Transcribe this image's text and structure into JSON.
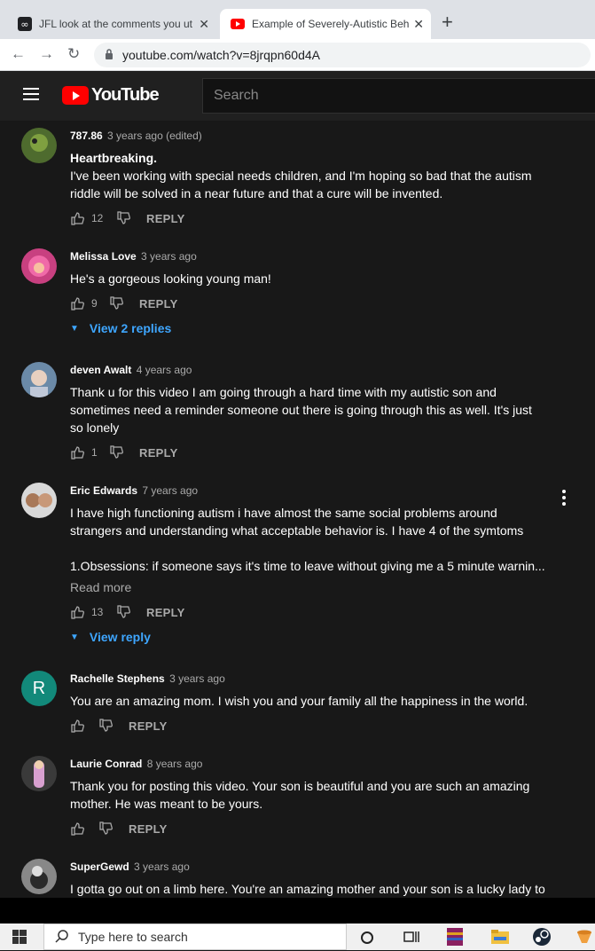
{
  "browser": {
    "tabs": [
      {
        "title": "JFL look at the comments you ut",
        "icon": "infinity-icon"
      },
      {
        "title": "Example of Severely-Autistic Beh",
        "icon": "youtube-icon"
      }
    ],
    "url": "youtube.com/watch?v=8jrqpn60d4A"
  },
  "youtube": {
    "logo_text": "YouTube",
    "search_placeholder": "Search"
  },
  "comments": [
    {
      "author": "787.86",
      "time": "3 years ago (edited)",
      "lines": [
        "Heartbreaking.",
        "I've been working with special needs children, and I'm hoping so bad that the autism",
        "riddle will be solved in a near future and that a cure will be invented."
      ],
      "likes": "12",
      "reply": "REPLY",
      "avatar_color": "#5a7a3a"
    },
    {
      "author": "Melissa Love",
      "time": "3 years ago",
      "lines": [
        "He's a gorgeous looking young man!"
      ],
      "likes": "9",
      "reply": "REPLY",
      "view_replies": "View 2 replies",
      "avatar_color": "#e85a9a"
    },
    {
      "author": "deven Awalt",
      "time": "4 years ago",
      "lines": [
        "Thank u for this video I am going through a hard time with my autistic son and",
        "sometimes need a reminder someone out there is going through this as well. It's just",
        "so lonely"
      ],
      "likes": "1",
      "reply": "REPLY",
      "avatar_color": "#8aa0b8"
    },
    {
      "author": "Eric Edwards",
      "time": "7 years ago",
      "lines": [
        "I have high functioning autism i have almost the same social problems around",
        "strangers and understanding what acceptable behavior is. I have 4 of the symtoms",
        "",
        "1.Obsessions: if someone says it's time to leave without giving me a 5 minute warnin..."
      ],
      "read_more": "Read more",
      "likes": "13",
      "reply": "REPLY",
      "view_replies": "View reply",
      "avatar_color": "#9a7a5a"
    },
    {
      "author": "Rachelle Stephens",
      "time": "3 years ago",
      "lines": [
        "You are an amazing mom. I wish you and your family all the happiness in the world."
      ],
      "likes": "",
      "reply": "REPLY",
      "avatar_letter": "R",
      "avatar_color": "#12897a"
    },
    {
      "author": "Laurie Conrad",
      "time": "8 years ago",
      "lines": [
        "Thank you for posting this video.  Your son is beautiful and you are such an amazing",
        "mother.  He was meant to be yours."
      ],
      "likes": "",
      "reply": "REPLY",
      "avatar_color": "#b890b0"
    },
    {
      "author": "SuperGewd",
      "time": "3 years ago",
      "lines": [
        "I gotta go out on a limb here. You're an amazing mother and your son is a lucky lady to"
      ],
      "avatar_color": "#555555"
    }
  ],
  "taskbar": {
    "search_placeholder": "Type here to search"
  }
}
